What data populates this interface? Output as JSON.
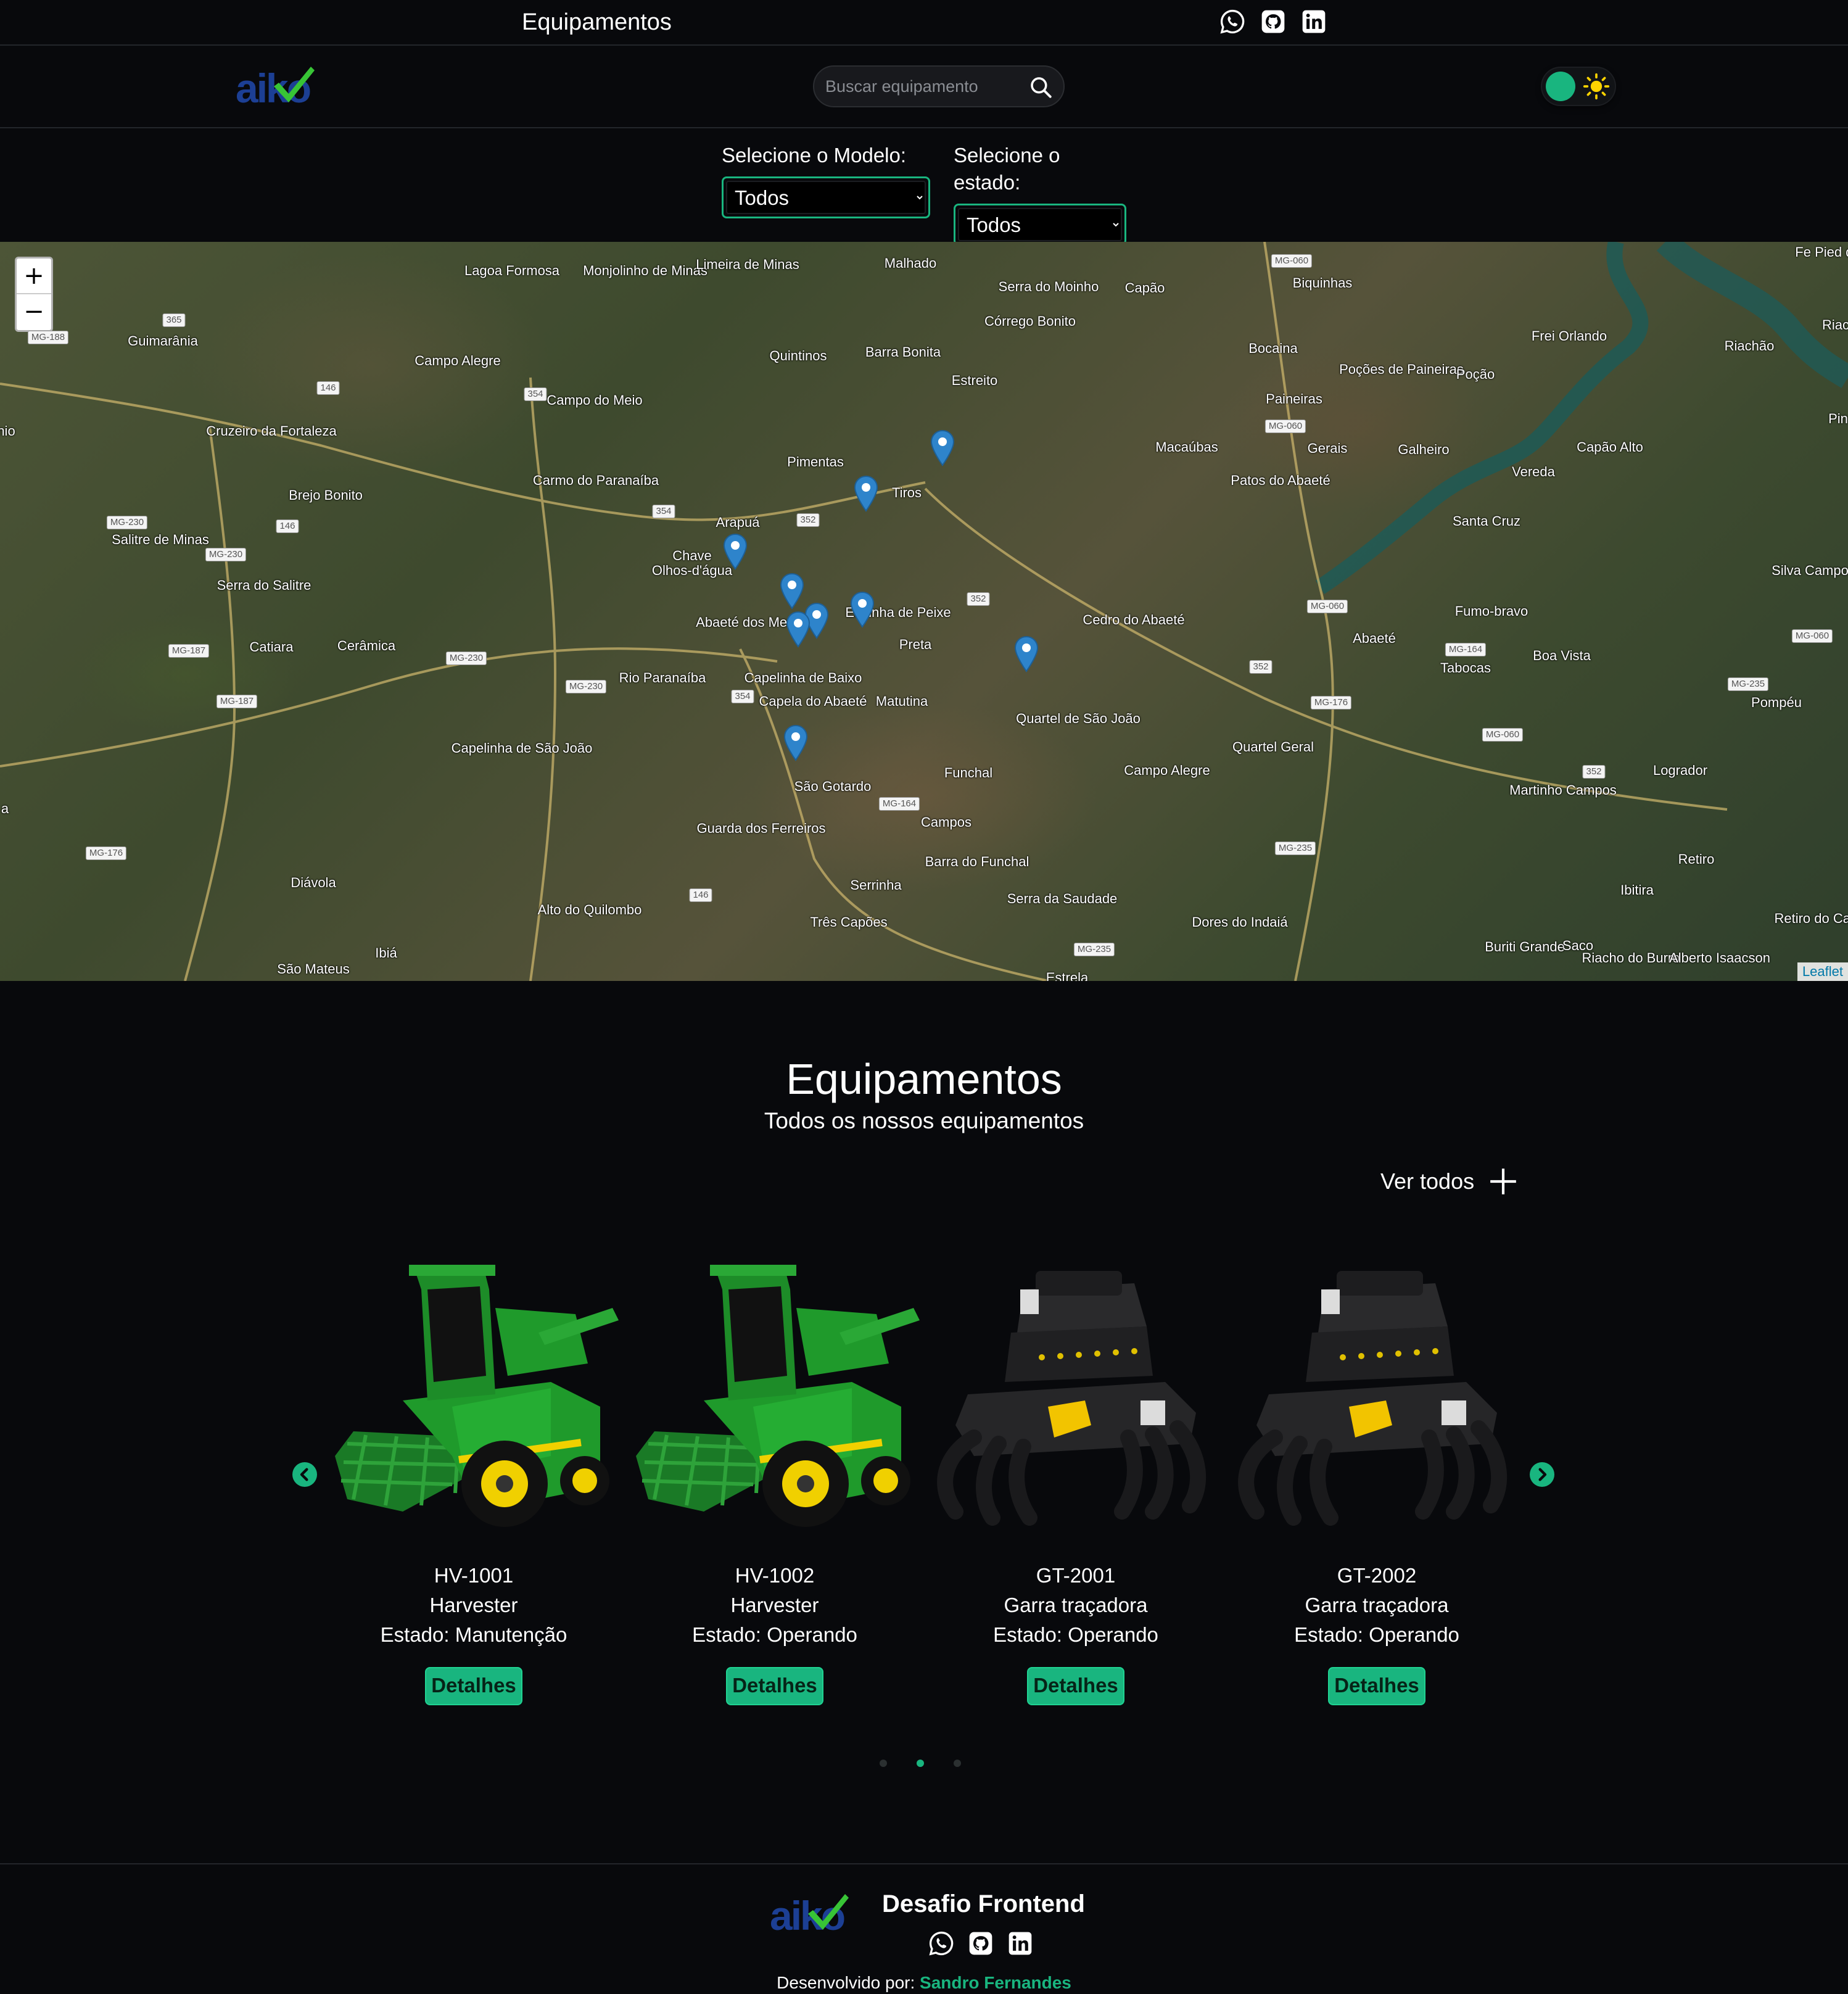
{
  "topbar": {
    "title": "Equipamentos",
    "social": [
      "whatsapp-icon",
      "github-icon",
      "linkedin-icon"
    ]
  },
  "header": {
    "logo_text": "aiko",
    "search": {
      "placeholder": "Buscar equipamento",
      "value": ""
    },
    "theme_toggle": {
      "state": "dark",
      "icon": "sun-icon"
    }
  },
  "filters": {
    "model": {
      "label": "Selecione o Modelo:",
      "selected": "Todos"
    },
    "state": {
      "label": "Selecione o estado:",
      "selected": "Todos"
    }
  },
  "map": {
    "zoom_in": "+",
    "zoom_out": "−",
    "attribution": "Leaflet",
    "places": [
      "Lagoa Formosa",
      "Monjolinho de Minas",
      "Limeira de Minas",
      "Malhado",
      "Serra do Moinho",
      "Córrego Bonito",
      "Capão",
      "Biquinhas",
      "Guimarânia",
      "Campo Alegre",
      "Quintinos",
      "Barra Bonita",
      "Estreito",
      "Bocaina",
      "Frei Orlando",
      "Riachão",
      "Poções de Paineiras",
      "Poção",
      "Paineiras",
      "Cruzeiro da Fortaleza",
      "Campo do Meio",
      "Pimentas",
      "Macaúbas",
      "Gerais",
      "Galheiro",
      "Capão Alto",
      "Brejo Bonito",
      "Carmo do Paranaíba",
      "Tiros",
      "Patos do Abaeté",
      "Vereda",
      "Arapuá",
      "Santa Cruz",
      "Salitre de Minas",
      "Chave",
      "Olhos-d'água",
      "Serra do Salitre",
      "Silva Campos",
      "Espinha de Peixe",
      "Preta",
      "Abaeté dos Mendes",
      "Cedro do Abaeté",
      "Fumo-bravo",
      "Abaeté",
      "Catiara",
      "Cerâmica",
      "Tabocas",
      "Boa Vista",
      "Rio Paranaíba",
      "Capelinha de Baixo",
      "Capela do Abaeté",
      "Matutina",
      "Quartel de São João",
      "Pompéu",
      "Quartel Geral",
      "Capelinha de São João",
      "Funchal",
      "Campo Alegre",
      "Logrador",
      "São Gotardo",
      "Martinho Campos",
      "Campos",
      "Guarda dos Ferreiros",
      "Barra do Funchal",
      "Retiro",
      "Diávola",
      "Serrinha",
      "Serra da Saudade",
      "Ibitira",
      "Alto do Quilombo",
      "Três Capões",
      "Dores do Indaiá",
      "Retiro do Campo B",
      "Ibiá",
      "São Mateus",
      "Buriti Grande",
      "Saco",
      "Riacho do Burro",
      "Alberto Isaacson",
      "Estrela",
      "Fe Pied do Ba",
      "Riac",
      "Pin",
      "nio",
      "a"
    ],
    "roads": [
      "MG-188",
      "365",
      "146",
      "354",
      "MG-230",
      "MG-230",
      "146",
      "354",
      "352",
      "MG-187",
      "MG-187",
      "MG-230",
      "MG-230",
      "354",
      "352",
      "MG-060",
      "MG-060",
      "MG-060",
      "352",
      "MG-176",
      "MG-060",
      "MG-164",
      "MG-060",
      "352",
      "MG-164",
      "MG-235",
      "MG-176",
      "146",
      "MG-235",
      "MG-235"
    ],
    "markers_count": 9
  },
  "section": {
    "title": "Equipamentos",
    "subtitle": "Todos os nossos equipamentos",
    "see_all": "Ver todos",
    "see_all_icon": "plus-icon"
  },
  "carousel": {
    "prev_icon": "chevron-left-icon",
    "next_icon": "chevron-right-icon",
    "items": [
      {
        "name": "HV-1001",
        "model": "Harvester",
        "state": "Estado: Manutenção",
        "button": "Detalhes",
        "image": "harvester"
      },
      {
        "name": "HV-1002",
        "model": "Harvester",
        "state": "Estado: Operando",
        "button": "Detalhes",
        "image": "harvester"
      },
      {
        "name": "GT-2001",
        "model": "Garra traçadora",
        "state": "Estado: Operando",
        "button": "Detalhes",
        "image": "grapple"
      },
      {
        "name": "GT-2002",
        "model": "Garra traçadora",
        "state": "Estado: Operando",
        "button": "Detalhes",
        "image": "grapple"
      }
    ],
    "pages": 3,
    "active_page": 2
  },
  "footer": {
    "title": "Desafio Frontend",
    "credit_prefix": "Desenvolvido por:",
    "author": "Sandro Fernandes",
    "social": [
      "whatsapp-icon",
      "github-icon",
      "linkedin-icon"
    ]
  },
  "colors": {
    "accent": "#19b57f",
    "background": "#08090c",
    "logo_blue": "#1c3f94",
    "logo_check": "#38c436"
  }
}
